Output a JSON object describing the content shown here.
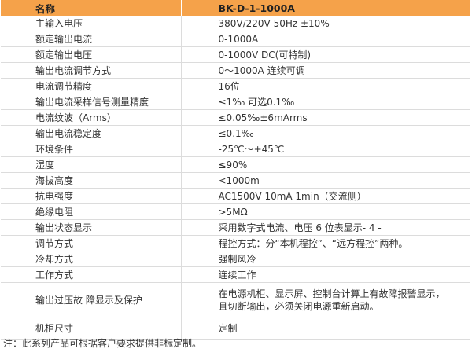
{
  "table": {
    "header": [
      "名称",
      "BK-D-1-1000A"
    ],
    "rows": [
      {
        "name": "主输入电压",
        "value": "380V/220V 50Hz ±10%"
      },
      {
        "name": "额定输出电流",
        "value": "0-1000A"
      },
      {
        "name": "额定输出电压",
        "value": "0-1000V DC(可特制)"
      },
      {
        "name": "输出电流调节方式",
        "value": "0～1000A 连续可调"
      },
      {
        "name": "电流调节精度",
        "value": "16位"
      },
      {
        "name": "输出电流采样信号测量精度",
        "value": "≤1‰ 可选0.1‰"
      },
      {
        "name": "电流纹波（Arms）",
        "value": "≤0.05‰±6mArms"
      },
      {
        "name": "输出电流稳定度",
        "value": "≤0.1‰"
      },
      {
        "name": "环境条件",
        "value": "-25℃～+45℃"
      },
      {
        "name": "湿度",
        "value": "≤90%"
      },
      {
        "name": "海拔高度",
        "value": "<1000m"
      },
      {
        "name": "抗电强度",
        "value": "AC1500V 10mA 1min（交流侧）"
      },
      {
        "name": "绝缘电阻",
        "value": ">5MΩ"
      },
      {
        "name": "输出状态显示",
        "value": "采用数字式电流、电压 6 位表显示- 4 -"
      },
      {
        "name": "调节方式",
        "value": "程控方式：分“本机程控”、“远方程控”两种。"
      },
      {
        "name": "冷却方式",
        "value": "强制风冷"
      },
      {
        "name": "工作方式",
        "value": "连续工作"
      },
      {
        "name": "输出过压故 障显示及保护",
        "value_lines": [
          "在电源机柜、显示屏、控制台计算上有故障报警显示，",
          "且切断输出，必须关闭电源重新启动。"
        ]
      },
      {
        "name": "机柜尺寸",
        "value": "定制"
      }
    ]
  },
  "footnote": "注：此系列产品可根据客户要求提供非标定制。"
}
